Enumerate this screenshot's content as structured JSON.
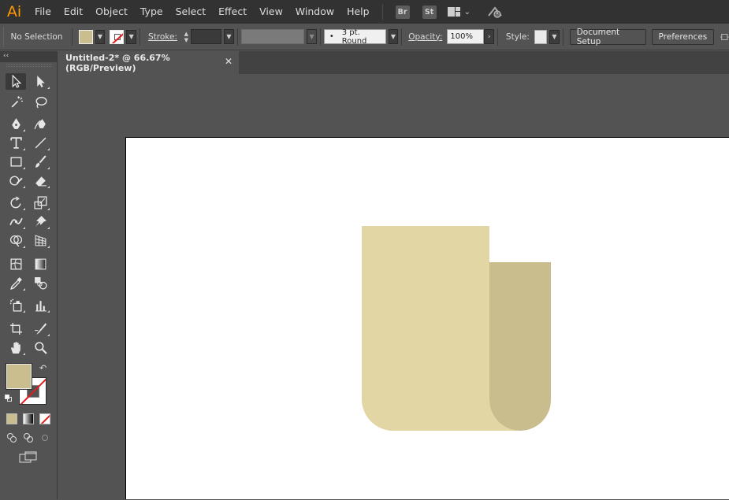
{
  "app": {
    "logo": "Ai",
    "menu": [
      "File",
      "Edit",
      "Object",
      "Type",
      "Select",
      "Effect",
      "View",
      "Window",
      "Help"
    ],
    "bridge_badge": "Br",
    "stock_badge": "St",
    "icons": [
      "workspace-switcher-icon",
      "gpu-performance-icon"
    ]
  },
  "control_bar": {
    "selection_label": "No Selection",
    "stroke_label": "Stroke:",
    "brush_profile": "3 pt. Round",
    "brush_profile_dot": "•",
    "opacity_label": "Opacity:",
    "opacity_value": "100%",
    "style_label": "Style:",
    "document_setup": "Document Setup",
    "preferences": "Preferences",
    "fill_color": "#cbbe8e",
    "stroke_color": "none"
  },
  "document": {
    "tab_title": "Untitled-2* @ 66.67% (RGB/Preview)",
    "close_glyph": "✕"
  },
  "toolbar": {
    "collapse_glyph": "‹‹",
    "swap_glyph": "↶",
    "tools": [
      "selection-tool",
      "direct-selection-tool",
      "magic-wand-tool",
      "lasso-tool",
      "pen-tool",
      "curvature-tool",
      "type-tool",
      "line-segment-tool",
      "rectangle-tool",
      "paintbrush-tool",
      "shaper-tool",
      "eraser-tool",
      "rotate-tool",
      "scale-tool",
      "width-tool",
      "free-transform-tool",
      "shape-builder-tool",
      "perspective-grid-tool",
      "mesh-tool",
      "gradient-tool",
      "eyedropper-tool",
      "blend-tool",
      "symbol-sprayer-tool",
      "column-graph-tool",
      "artboard-tool",
      "slice-tool",
      "hand-tool",
      "zoom-tool"
    ]
  },
  "artwork": {
    "front_color": "#e1d6a4",
    "back_color": "#c9bd8e"
  }
}
